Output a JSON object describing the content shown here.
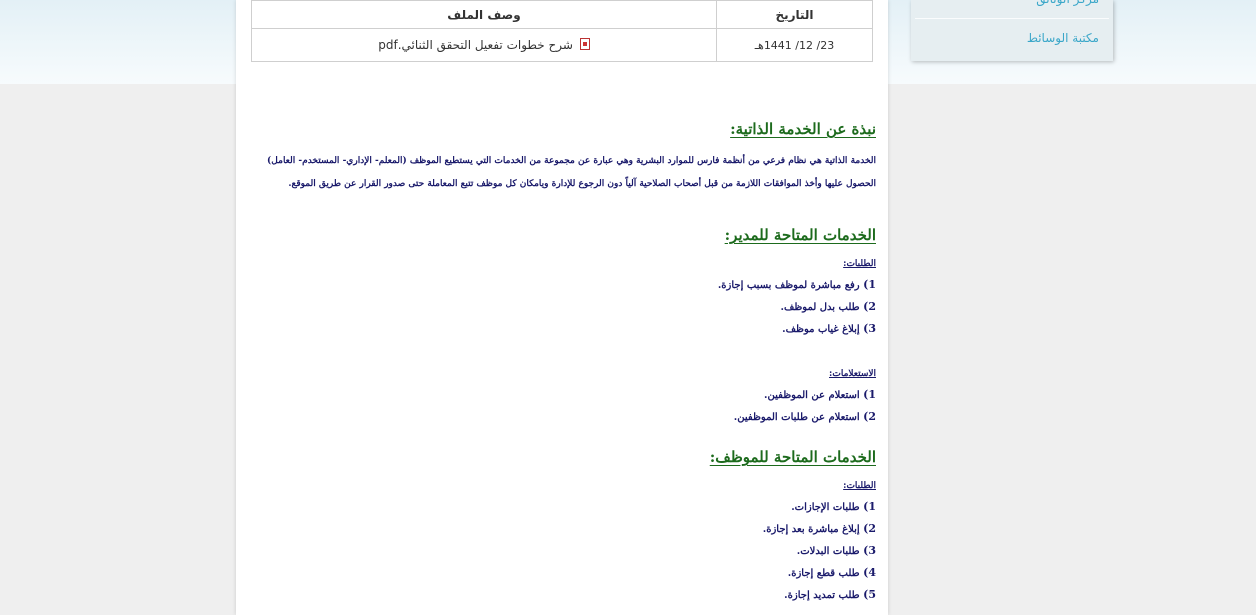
{
  "files_table": {
    "headers": {
      "date": "التاريخ",
      "description": "وصف الملف"
    },
    "rows": [
      {
        "date": "23/ 12/ 1441هـ",
        "file": "شرح خطوات تفعيل التحقق الثنائي.pdf"
      }
    ]
  },
  "sidebar": {
    "items": [
      {
        "label": "مركز الوثائق"
      },
      {
        "label": "مكتبة الوسائط"
      }
    ]
  },
  "article": {
    "about": {
      "title": "نبذة عن الخدمة الذاتية:",
      "text_line1": "الخدمة الذاتية هي نظام فرعي من أنظمة فارس للموارد البشرية وهي عبارة عن مجموعة من الخدمات التي يستطيع الموظف (المعلم- الإداري- المستخدم- العامل)",
      "text_line2": "الحصول عليها وأخذ الموافقات اللازمة من قبل أصحاب الصلاحية آلياً دون الرجوع للإدارة ويامكان كل موظف تتبع المعاملة حتى صدور القرار عن طريق الموقع."
    },
    "manager": {
      "title": "الخدمات المتاحة للمدير:",
      "requests_label": "الطلبات:",
      "requests": [
        {
          "num": "1)",
          "text": "رفع مباشرة لموظف بسبب إجازة."
        },
        {
          "num": "2)",
          "text": "طلب بدل لموظف."
        },
        {
          "num": "3)",
          "text": "إبلاغ غياب موظف."
        }
      ],
      "inquiries_label": "الاستعلامات:",
      "inquiries": [
        {
          "num": "1)",
          "text": "استعلام عن الموظفين."
        },
        {
          "num": "2)",
          "text": "استعلام عن طلبات الموظفين."
        }
      ]
    },
    "employee": {
      "title": "الخدمات المتاحة للموظف:",
      "requests_label": "الطلبات:",
      "requests": [
        {
          "num": "1)",
          "text": "طلبات الإجازات."
        },
        {
          "num": "2)",
          "text": "إبلاغ مباشرة بعد إجازة."
        },
        {
          "num": "3)",
          "text": "طلبات البدلات."
        },
        {
          "num": "4)",
          "text": "طلب قطع إجازة."
        },
        {
          "num": "5)",
          "text": "طلب تمديد إجازة."
        }
      ]
    }
  },
  "colors": {
    "heading": "#1d6b1d",
    "body_text": "#1a1a6b",
    "sidebar_link": "#3ba7c9"
  },
  "icons": {
    "file": "pdf-icon"
  }
}
